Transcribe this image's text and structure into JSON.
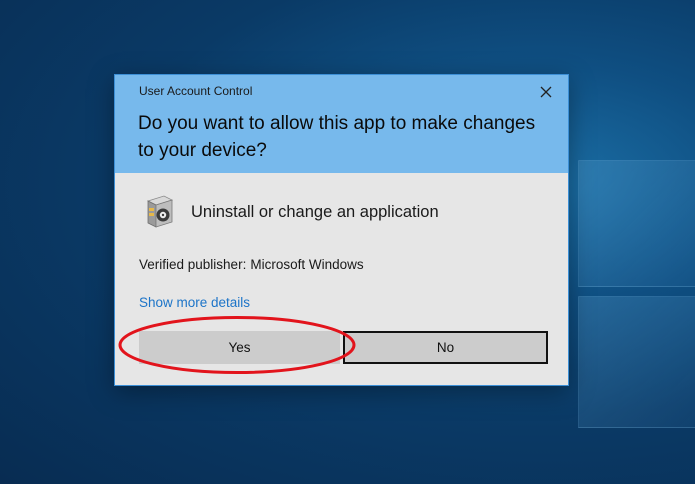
{
  "dialog": {
    "title": "User Account Control",
    "question": "Do you want to allow this app to make changes to your device?",
    "app_name": "Uninstall or change an application",
    "publisher_label": "Verified publisher:",
    "publisher_name": "Microsoft Windows",
    "details_link": "Show more details",
    "yes_label": "Yes",
    "no_label": "No",
    "close_icon": "close-icon",
    "app_icon": "program-box-icon"
  },
  "colors": {
    "header": "#77b9ec",
    "body": "#e6e6e6",
    "link": "#1c74c8",
    "annotation": "#e2141c",
    "desktop": "#0a3a66"
  }
}
